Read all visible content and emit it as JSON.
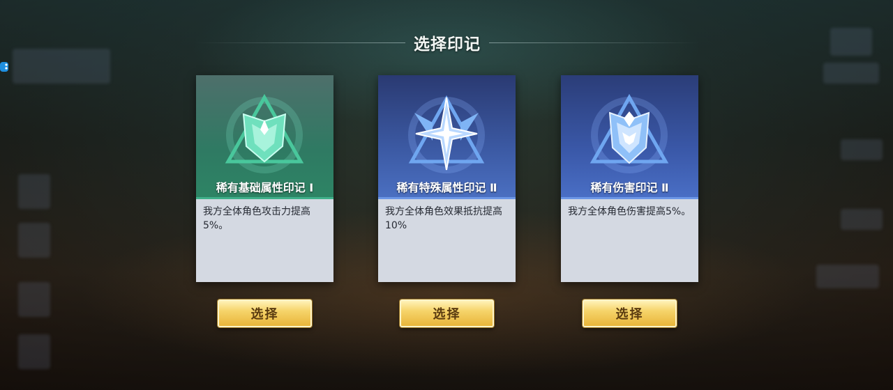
{
  "header": {
    "title": "选择印记"
  },
  "cards": [
    {
      "name": "稀有基础属性印记 Ⅰ",
      "description": "我方全体角色攻击力提高5%。",
      "theme": "green",
      "accent": "#2d8464",
      "emblem_icon": "shield-emblem-icon"
    },
    {
      "name": "稀有特殊属性印记 Ⅱ",
      "description": "我方全体角色效果抵抗提高10%",
      "theme": "blue",
      "accent": "#4b70c2",
      "emblem_icon": "star-emblem-icon"
    },
    {
      "name": "稀有伤害印记 Ⅱ",
      "description": "我方全体角色伤害提高5%。",
      "theme": "blue",
      "accent": "#4a6fc6",
      "emblem_icon": "crest-emblem-icon"
    }
  ],
  "buttons": {
    "select_label": "选择"
  },
  "colors": {
    "button_gold": "#f6d46a",
    "card_body": "#d4d9e2"
  }
}
